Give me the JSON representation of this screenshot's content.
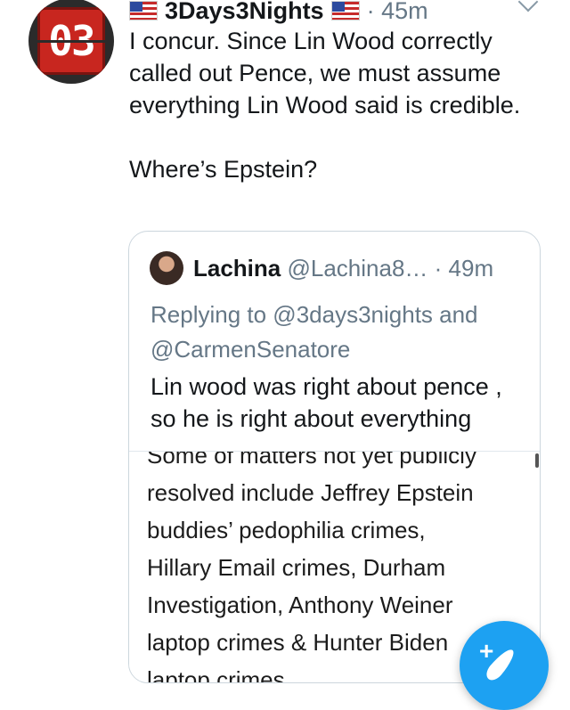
{
  "tweet": {
    "avatar_text": "03",
    "author_name": "3Days3Nights",
    "time": "· 45m",
    "paragraph1": "I concur. Since Lin Wood correctly called out Pence, we must assume everything Lin Wood said is credible.",
    "paragraph2": "Where’s Epstein?"
  },
  "quoted": {
    "name": "Lachina",
    "handle": "@Lachina8…",
    "time": "· 49m",
    "replying_to": "Replying to @3days3nights and @CarmenSenatore",
    "text": "Lin wood was right about pence , so he is right about everything",
    "image_text": {
      "line0": "Some of matters not yet publicly",
      "line1": "resolved include Jeffrey Epstein",
      "line2": "buddies’ pedophilia crimes,",
      "line3": "Hillary Email crimes, Durham",
      "line4": "Investigation, Anthony Weiner",
      "line5": "laptop crimes & Hunter Biden",
      "line6": "laptop crimes."
    }
  },
  "fab": {
    "plus": "+"
  },
  "colors": {
    "accent": "#1da1f2",
    "secondary_text": "#657786",
    "text": "#14171a"
  }
}
